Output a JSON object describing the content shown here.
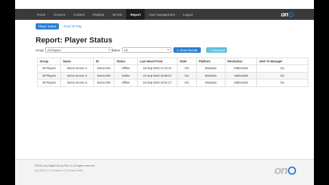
{
  "nav": {
    "items": [
      "Home",
      "Screens",
      "Content",
      "Playlists",
      "Wi Info",
      "Report",
      "User management",
      "Logout"
    ],
    "active_index": 5,
    "logo_text": "on"
  },
  "tabs": [
    {
      "label": "Player Status",
      "active": true
    },
    {
      "label": "Proof Of Play",
      "active": false
    }
  ],
  "page_title": "Report: Player Status",
  "filters": {
    "group_label": "Group",
    "group_value": "All Players",
    "status_label": "Status",
    "status_value": "All",
    "show_results_label": "Show Results",
    "download_label": "Download"
  },
  "table": {
    "columns": [
      "Group",
      "Name",
      "ID",
      "Status",
      "Last Heard From",
      "State",
      "Platform",
      "Resolution",
      "Alert To Manager"
    ],
    "rows": [
      [
        "All Players",
        "Demo Screen 1",
        "Demo-001",
        "Offline",
        "16-Sep-2020 17:14:47",
        "VIC",
        "Windows",
        "1080x1920",
        "No"
      ],
      [
        "All Players",
        "Demo Screen 2",
        "Demo-002",
        "Online",
        "24-Sep-2020 15:08:17",
        "VIC",
        "Windows",
        "1920x1080",
        "No"
      ],
      [
        "All Players",
        "Demo Screen 3",
        "Demo-003",
        "Offline",
        "16-Sep-2020 10:51:17",
        "VIC",
        "Windows",
        "1080x1920",
        "No"
      ]
    ]
  },
  "footer": {
    "copyright": "©2020 onQ Digital Group Pty Ltd. All rights reserved.",
    "version": "onQ CMS V.1.4 | Version 1.0 | Privacy Policy",
    "logo_text": "on"
  },
  "colors": {
    "accent": "#2a7fd4",
    "navbar": "#3a3a3a",
    "download": "#5bc0de"
  }
}
